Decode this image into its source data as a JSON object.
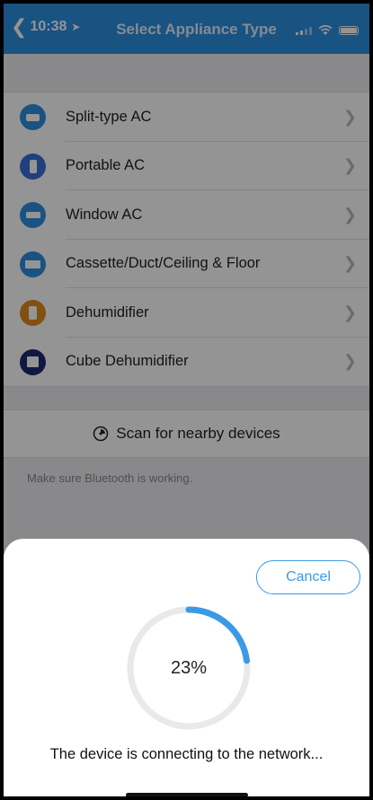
{
  "status_bar": {
    "time": "10:38"
  },
  "nav": {
    "title": "Select Appliance Type"
  },
  "appliances": [
    {
      "label": "Split-type AC",
      "icon": "split-ac-icon",
      "color": "#2d8fe0"
    },
    {
      "label": "Portable AC",
      "icon": "portable-ac-icon",
      "color": "#3a6fd8"
    },
    {
      "label": "Window AC",
      "icon": "window-ac-icon",
      "color": "#2d8fe0"
    },
    {
      "label": "Cassette/Duct/Ceiling & Floor",
      "icon": "cassette-ac-icon",
      "color": "#2d8fe0"
    },
    {
      "label": "Dehumidifier",
      "icon": "dehumidifier-icon",
      "color": "#e08a1e"
    },
    {
      "label": "Cube Dehumidifier",
      "icon": "cube-dehumidifier-icon",
      "color": "#1e2a6e"
    }
  ],
  "scan": {
    "label": "Scan for nearby devices"
  },
  "hint": "Make sure Bluetooth is working.",
  "dialog": {
    "cancel_label": "Cancel",
    "progress": 23,
    "progress_text": "23%",
    "message": "The device is connecting to the network...",
    "accent": "#3a9ae6"
  }
}
